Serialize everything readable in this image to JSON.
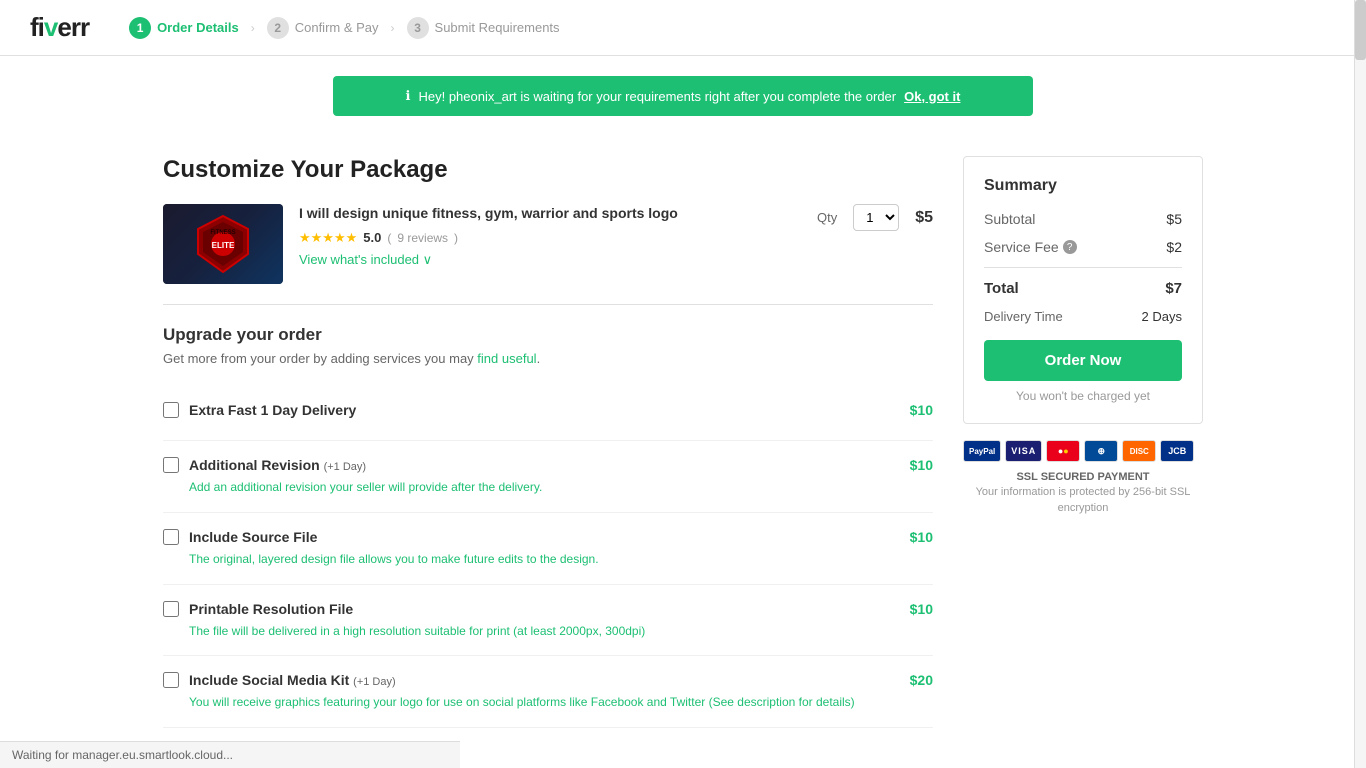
{
  "header": {
    "logo": "fiverr",
    "steps": [
      {
        "number": "1",
        "label": "Order Details",
        "state": "active"
      },
      {
        "number": "2",
        "label": "Confirm & Pay",
        "state": "inactive"
      },
      {
        "number": "3",
        "label": "Submit Requirements",
        "state": "inactive"
      }
    ]
  },
  "alert": {
    "message": "Hey! pheonix_art is waiting for your requirements right after you complete the order",
    "link_text": "Ok, got it",
    "icon": "ℹ"
  },
  "page": {
    "title": "Customize Your Package"
  },
  "product": {
    "title": "I will design unique fitness, gym, warrior and sports logo",
    "rating": "5.0",
    "review_count": "9 reviews",
    "qty_label": "Qty",
    "qty_value": "1",
    "price": "$5",
    "view_included": "View what's included ∨"
  },
  "upgrade": {
    "title": "Upgrade your order",
    "subtitle": "Get more from your order by adding services you may find useful.",
    "items": [
      {
        "name": "Extra Fast 1 Day Delivery",
        "tag": "",
        "price": "$10",
        "desc": ""
      },
      {
        "name": "Additional Revision",
        "tag": "(+1 Day)",
        "price": "$10",
        "desc": "Add an additional revision your seller will provide after the delivery."
      },
      {
        "name": "Include Source File",
        "tag": "",
        "price": "$10",
        "desc": "The original, layered design file allows you to make future edits to the design."
      },
      {
        "name": "Printable Resolution File",
        "tag": "",
        "price": "$10",
        "desc_mixed": "The file will be delivered in a high resolution suitable for print (at least 2000px, 300dpi)"
      },
      {
        "name": "Include Social Media Kit",
        "tag": "(+1 Day)",
        "price": "$20",
        "desc": "You will receive graphics featuring your logo for use on social platforms like Facebook and Twitter (See description for details)"
      }
    ]
  },
  "summary": {
    "title": "Summary",
    "subtotal_label": "Subtotal",
    "subtotal_value": "$5",
    "service_fee_label": "Service Fee",
    "service_fee_value": "$2",
    "total_label": "Total",
    "total_value": "$7",
    "delivery_label": "Delivery Time",
    "delivery_value": "2 Days",
    "order_btn": "Order Now",
    "no_charge": "You won't be charged yet"
  },
  "payment": {
    "methods": [
      {
        "name": "PayPal",
        "class": "paypal",
        "label": "PayPal"
      },
      {
        "name": "Visa",
        "class": "visa",
        "label": "VISA"
      },
      {
        "name": "Mastercard",
        "class": "mastercard",
        "label": "MC"
      },
      {
        "name": "Diners",
        "class": "diners",
        "label": "DC"
      },
      {
        "name": "Discover",
        "class": "discover",
        "label": "DISCOVER"
      },
      {
        "name": "JCB",
        "class": "jcb",
        "label": "JCB"
      }
    ],
    "ssl_title": "SSL SECURED PAYMENT",
    "ssl_desc": "Your information is protected by 256-bit SSL encryption"
  },
  "status_bar": {
    "text": "Waiting for manager.eu.smartlook.cloud..."
  }
}
